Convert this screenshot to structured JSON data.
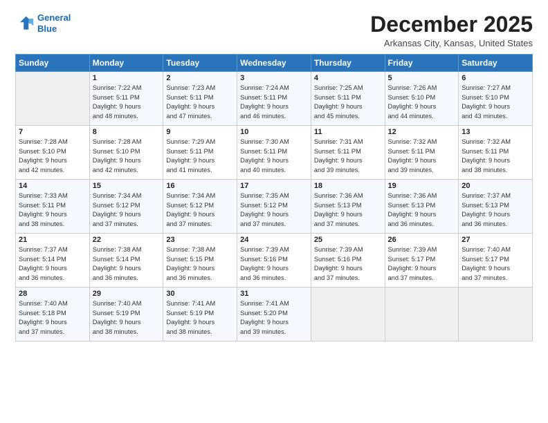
{
  "logo": {
    "line1": "General",
    "line2": "Blue"
  },
  "title": "December 2025",
  "location": "Arkansas City, Kansas, United States",
  "days_of_week": [
    "Sunday",
    "Monday",
    "Tuesday",
    "Wednesday",
    "Thursday",
    "Friday",
    "Saturday"
  ],
  "weeks": [
    [
      {
        "day": "",
        "info": ""
      },
      {
        "day": "1",
        "info": "Sunrise: 7:22 AM\nSunset: 5:11 PM\nDaylight: 9 hours\nand 48 minutes."
      },
      {
        "day": "2",
        "info": "Sunrise: 7:23 AM\nSunset: 5:11 PM\nDaylight: 9 hours\nand 47 minutes."
      },
      {
        "day": "3",
        "info": "Sunrise: 7:24 AM\nSunset: 5:11 PM\nDaylight: 9 hours\nand 46 minutes."
      },
      {
        "day": "4",
        "info": "Sunrise: 7:25 AM\nSunset: 5:11 PM\nDaylight: 9 hours\nand 45 minutes."
      },
      {
        "day": "5",
        "info": "Sunrise: 7:26 AM\nSunset: 5:10 PM\nDaylight: 9 hours\nand 44 minutes."
      },
      {
        "day": "6",
        "info": "Sunrise: 7:27 AM\nSunset: 5:10 PM\nDaylight: 9 hours\nand 43 minutes."
      }
    ],
    [
      {
        "day": "7",
        "info": "Sunrise: 7:28 AM\nSunset: 5:10 PM\nDaylight: 9 hours\nand 42 minutes."
      },
      {
        "day": "8",
        "info": "Sunrise: 7:28 AM\nSunset: 5:10 PM\nDaylight: 9 hours\nand 42 minutes."
      },
      {
        "day": "9",
        "info": "Sunrise: 7:29 AM\nSunset: 5:11 PM\nDaylight: 9 hours\nand 41 minutes."
      },
      {
        "day": "10",
        "info": "Sunrise: 7:30 AM\nSunset: 5:11 PM\nDaylight: 9 hours\nand 40 minutes."
      },
      {
        "day": "11",
        "info": "Sunrise: 7:31 AM\nSunset: 5:11 PM\nDaylight: 9 hours\nand 39 minutes."
      },
      {
        "day": "12",
        "info": "Sunrise: 7:32 AM\nSunset: 5:11 PM\nDaylight: 9 hours\nand 39 minutes."
      },
      {
        "day": "13",
        "info": "Sunrise: 7:32 AM\nSunset: 5:11 PM\nDaylight: 9 hours\nand 38 minutes."
      }
    ],
    [
      {
        "day": "14",
        "info": "Sunrise: 7:33 AM\nSunset: 5:11 PM\nDaylight: 9 hours\nand 38 minutes."
      },
      {
        "day": "15",
        "info": "Sunrise: 7:34 AM\nSunset: 5:12 PM\nDaylight: 9 hours\nand 37 minutes."
      },
      {
        "day": "16",
        "info": "Sunrise: 7:34 AM\nSunset: 5:12 PM\nDaylight: 9 hours\nand 37 minutes."
      },
      {
        "day": "17",
        "info": "Sunrise: 7:35 AM\nSunset: 5:12 PM\nDaylight: 9 hours\nand 37 minutes."
      },
      {
        "day": "18",
        "info": "Sunrise: 7:36 AM\nSunset: 5:13 PM\nDaylight: 9 hours\nand 37 minutes."
      },
      {
        "day": "19",
        "info": "Sunrise: 7:36 AM\nSunset: 5:13 PM\nDaylight: 9 hours\nand 36 minutes."
      },
      {
        "day": "20",
        "info": "Sunrise: 7:37 AM\nSunset: 5:13 PM\nDaylight: 9 hours\nand 36 minutes."
      }
    ],
    [
      {
        "day": "21",
        "info": "Sunrise: 7:37 AM\nSunset: 5:14 PM\nDaylight: 9 hours\nand 36 minutes."
      },
      {
        "day": "22",
        "info": "Sunrise: 7:38 AM\nSunset: 5:14 PM\nDaylight: 9 hours\nand 36 minutes."
      },
      {
        "day": "23",
        "info": "Sunrise: 7:38 AM\nSunset: 5:15 PM\nDaylight: 9 hours\nand 36 minutes."
      },
      {
        "day": "24",
        "info": "Sunrise: 7:39 AM\nSunset: 5:16 PM\nDaylight: 9 hours\nand 36 minutes."
      },
      {
        "day": "25",
        "info": "Sunrise: 7:39 AM\nSunset: 5:16 PM\nDaylight: 9 hours\nand 37 minutes."
      },
      {
        "day": "26",
        "info": "Sunrise: 7:39 AM\nSunset: 5:17 PM\nDaylight: 9 hours\nand 37 minutes."
      },
      {
        "day": "27",
        "info": "Sunrise: 7:40 AM\nSunset: 5:17 PM\nDaylight: 9 hours\nand 37 minutes."
      }
    ],
    [
      {
        "day": "28",
        "info": "Sunrise: 7:40 AM\nSunset: 5:18 PM\nDaylight: 9 hours\nand 37 minutes."
      },
      {
        "day": "29",
        "info": "Sunrise: 7:40 AM\nSunset: 5:19 PM\nDaylight: 9 hours\nand 38 minutes."
      },
      {
        "day": "30",
        "info": "Sunrise: 7:41 AM\nSunset: 5:19 PM\nDaylight: 9 hours\nand 38 minutes."
      },
      {
        "day": "31",
        "info": "Sunrise: 7:41 AM\nSunset: 5:20 PM\nDaylight: 9 hours\nand 39 minutes."
      },
      {
        "day": "",
        "info": ""
      },
      {
        "day": "",
        "info": ""
      },
      {
        "day": "",
        "info": ""
      }
    ]
  ]
}
